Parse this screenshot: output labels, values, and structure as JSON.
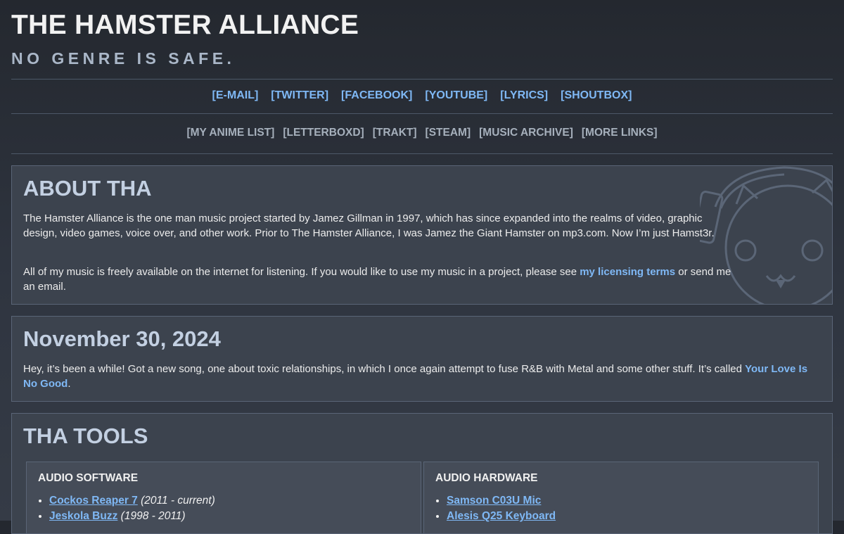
{
  "header": {
    "title": "THE HAMSTER ALLIANCE",
    "tagline": "NO GENRE IS SAFE."
  },
  "nav_primary": [
    "[E-MAIL]",
    "[TWITTER]",
    "[FACEBOOK]",
    "[YOUTUBE]",
    "[LYRICS]",
    "[SHOUTBOX]"
  ],
  "nav_secondary": [
    "[MY ANIME LIST]",
    "[LETTERBOXD]",
    "[TRAKT]",
    "[STEAM]",
    "[MUSIC ARCHIVE]",
    "[MORE LINKS]"
  ],
  "about": {
    "heading": "ABOUT THA",
    "para1": "The Hamster Alliance is the one man music project started by Jamez Gillman in 1997, which has since expanded into the realms of video, graphic design, video games, voice over, and other work. Prior to The Hamster Alliance, I was Jamez the Giant Hamster on mp3.com. Now I’m just Hamst3r.",
    "para2_before": "All of my music is freely available on the internet for listening. If you would like to use my music in a project, please see ",
    "para2_link": "my licensing terms",
    "para2_after": " or send me an email."
  },
  "news": {
    "heading": "November 30, 2024",
    "text_before": "Hey, it’s been a while! Got a new song, one about toxic relationships, in which I once again attempt to fuse R&B with Metal and some other stuff. It’s called ",
    "link": "Your Love Is No Good",
    "text_after": "."
  },
  "tools": {
    "heading": "THA TOOLS",
    "software": {
      "heading": "AUDIO SOFTWARE",
      "items": [
        {
          "name": "Cockos Reaper 7",
          "years": " (2011 - current)"
        },
        {
          "name": "Jeskola Buzz",
          "years": " (1998 - 2011)"
        }
      ]
    },
    "hardware": {
      "heading": "AUDIO HARDWARE",
      "items": [
        {
          "name": "Samson C03U Mic"
        },
        {
          "name": "Alesis Q25 Keyboard"
        }
      ]
    }
  },
  "colors": {
    "link": "#7fb8f5",
    "heading": "#c3d0e2",
    "panel_bg": "#3c434e",
    "page_bg": "#2a2f37"
  }
}
